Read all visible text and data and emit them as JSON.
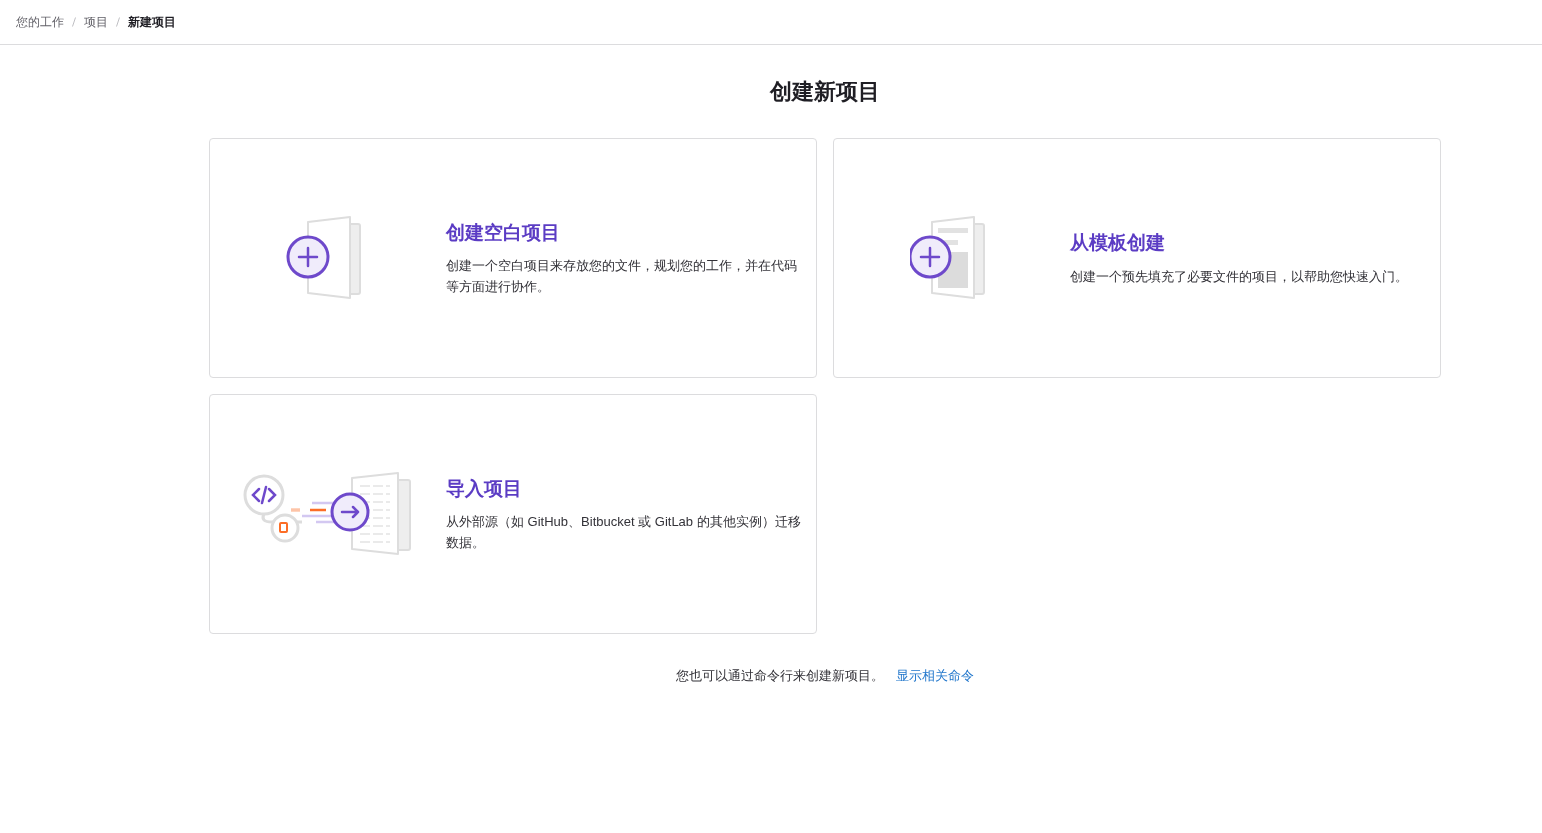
{
  "breadcrumb": [
    {
      "label": "您的工作",
      "current": false
    },
    {
      "label": "项目",
      "current": false
    },
    {
      "label": "新建项目",
      "current": true
    }
  ],
  "page_title": "创建新项目",
  "cards": [
    {
      "kind": "blank",
      "title": "创建空白项目",
      "description": "创建一个空白项目来存放您的文件，规划您的工作，并在代码等方面进行协作。"
    },
    {
      "kind": "template",
      "title": "从模板创建",
      "description": "创建一个预先填充了必要文件的项目，以帮助您快速入门。"
    },
    {
      "kind": "import",
      "title": "导入项目",
      "description": "从外部源（如 GitHub、Bitbucket 或 GitLab 的其他实例）迁移数据。"
    }
  ],
  "footer": {
    "text": "您也可以通过命令行来创建新项目。",
    "link": "显示相关命令"
  }
}
